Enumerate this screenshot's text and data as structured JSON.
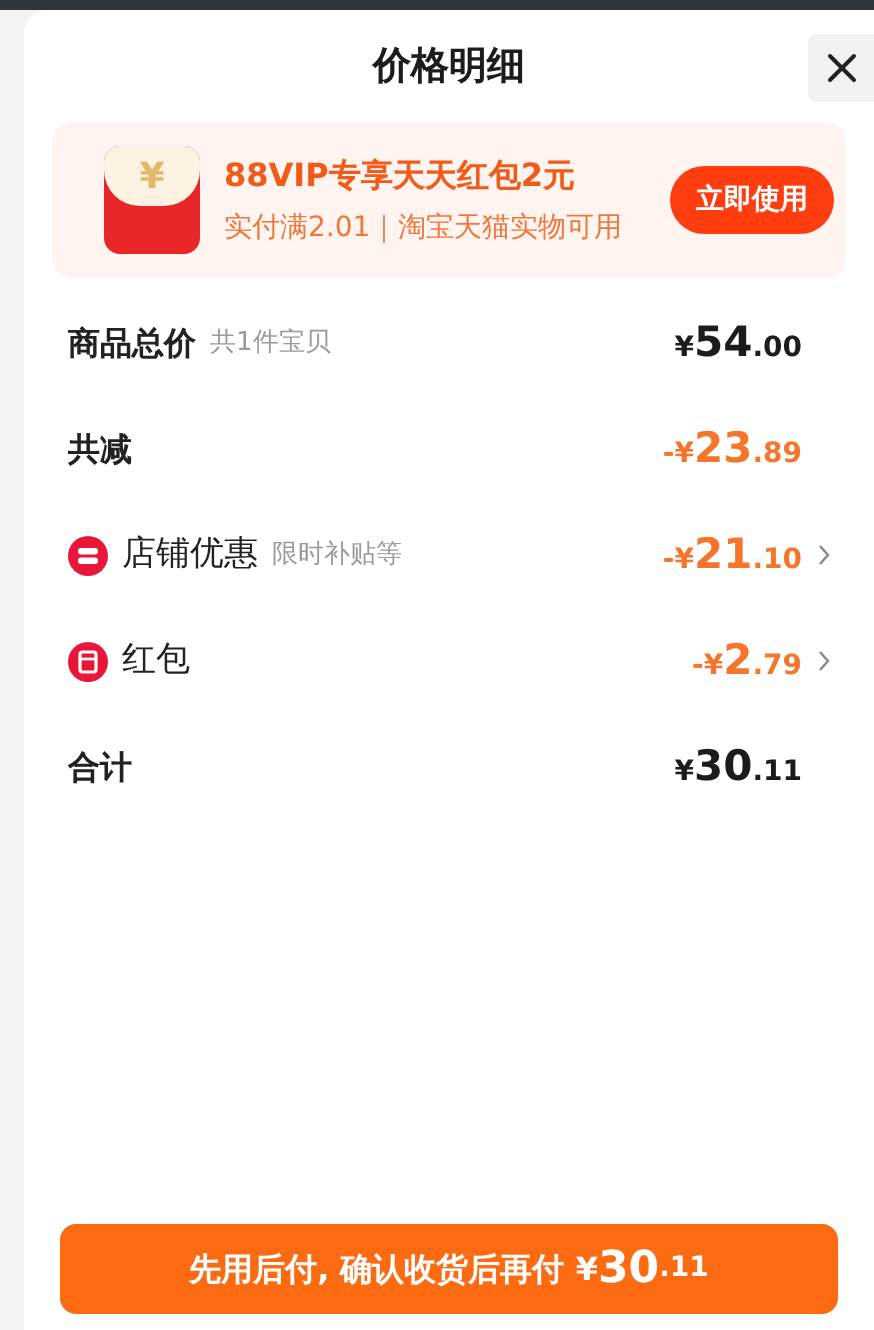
{
  "sheet": {
    "title": "价格明细"
  },
  "promo": {
    "title": "88VIP专享天天红包2元",
    "subtitle": "实付满2.01｜淘宝天猫实物可用",
    "icon_glyph": "¥",
    "action": "立即使用"
  },
  "rows": [
    {
      "kind": "header",
      "label": "商品总价",
      "note": "共1件宝贝",
      "sign": "",
      "currency": "¥",
      "integer": "54",
      "fraction": ".00",
      "discount": false,
      "expandable": false
    },
    {
      "kind": "header",
      "label": "共减",
      "sign": "-",
      "currency": "¥",
      "integer": "23",
      "fraction": ".89",
      "discount": true,
      "expandable": false
    },
    {
      "kind": "store",
      "label": "店铺优惠",
      "note": "限时补贴等",
      "sign": "-",
      "currency": "¥",
      "integer": "21",
      "fraction": ".10",
      "discount": true,
      "expandable": true
    },
    {
      "kind": "envelope",
      "label": "红包",
      "sign": "-",
      "currency": "¥",
      "integer": "2",
      "fraction": ".79",
      "discount": true,
      "expandable": true
    },
    {
      "kind": "header",
      "label": "合计",
      "sign": "",
      "currency": "¥",
      "integer": "30",
      "fraction": ".11",
      "discount": false,
      "expandable": false
    }
  ],
  "pay_button": {
    "label": "先用后付, 确认收货后再付",
    "currency": "¥",
    "integer": "30",
    "fraction": ".11"
  }
}
